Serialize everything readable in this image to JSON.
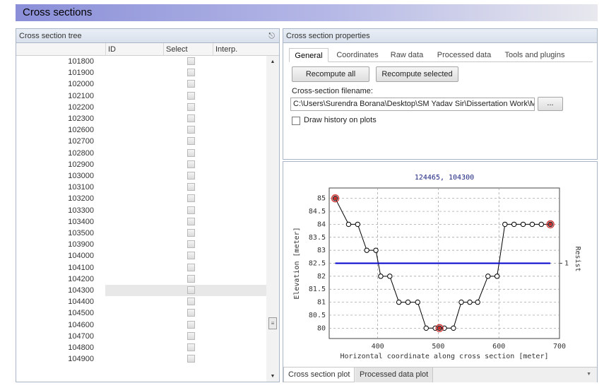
{
  "window": {
    "title": "Cross sections"
  },
  "tree_panel": {
    "title": "Cross section tree",
    "columns": [
      "ID",
      "Select",
      "Interp."
    ],
    "rows": [
      "101800",
      "101900",
      "102000",
      "102100",
      "102200",
      "102300",
      "102600",
      "102700",
      "102800",
      "102900",
      "103000",
      "103100",
      "103200",
      "103300",
      "103400",
      "103500",
      "103900",
      "104000",
      "104100",
      "104200",
      "104300",
      "104400",
      "104500",
      "104600",
      "104700",
      "104800",
      "104900"
    ],
    "selected_row": "104300"
  },
  "properties": {
    "title": "Cross section properties",
    "tabs": [
      "General",
      "Coordinates",
      "Raw data",
      "Processed data",
      "Tools and plugins"
    ],
    "active_tab": "General",
    "recompute_all": "Recompute all",
    "recompute_selected": "Recompute selected",
    "filename_label": "Cross-section filename:",
    "filename_value": "C:\\Users\\Surendra Borana\\Desktop\\SM Yadav Sir\\Dissertation Work\\MIK",
    "browse_label": "...",
    "draw_history_label": "Draw history on plots",
    "draw_history_checked": false
  },
  "plot_tabs": [
    "Cross section plot",
    "Processed data plot"
  ],
  "chart_data": {
    "type": "line",
    "title": "124465, 104300",
    "xlabel": "Horizontal coordinate along cross section [meter]",
    "ylabel": "Elevation [meter]",
    "y2label": "Resist",
    "y2_tick": "1",
    "xlim": [
      320,
      700
    ],
    "ylim": [
      79.6,
      85.4
    ],
    "x_ticks": [
      400,
      500,
      600,
      700
    ],
    "y_ticks": [
      80,
      80.5,
      81,
      81.5,
      82,
      82.5,
      83,
      83.5,
      84,
      84.5,
      85
    ],
    "grid": true,
    "series": [
      {
        "color": "#000000",
        "x": [
          330,
          352,
          367,
          382,
          397,
          405,
          420,
          435,
          450,
          466,
          480,
          495,
          502,
          510,
          525,
          538,
          552,
          565,
          582,
          597,
          610,
          625,
          640,
          655,
          670,
          685
        ],
        "y": [
          85,
          84,
          84,
          83,
          83,
          82,
          82,
          81,
          81,
          81,
          80,
          80,
          80,
          80,
          80,
          81,
          81,
          81,
          82,
          82,
          84,
          84,
          84,
          84,
          84,
          84
        ],
        "markers": "circle"
      },
      {
        "color": "#0000cc",
        "x": [
          330,
          685
        ],
        "y": [
          82.5,
          82.5
        ]
      }
    ],
    "highlighted_x": [
      330,
      502,
      685
    ]
  }
}
